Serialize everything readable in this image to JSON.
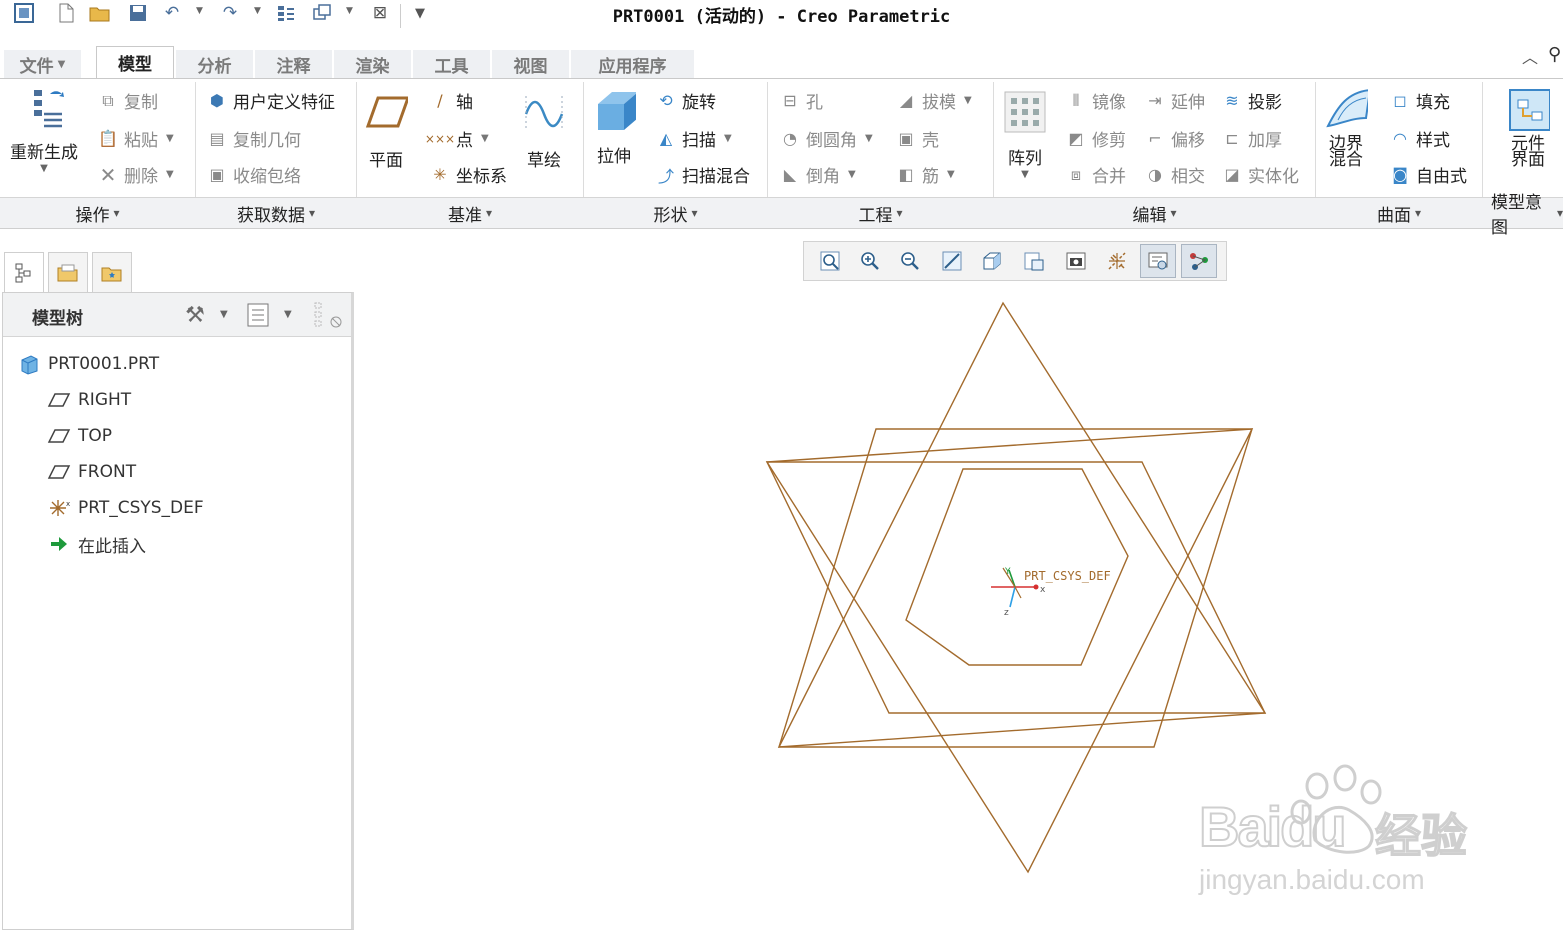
{
  "window": {
    "title": "PRT0001 (活动的) - Creo Parametric"
  },
  "tabs": [
    {
      "label": "文件",
      "dropdown": true
    },
    {
      "label": "模型",
      "active": true
    },
    {
      "label": "分析"
    },
    {
      "label": "注释"
    },
    {
      "label": "渲染"
    },
    {
      "label": "工具"
    },
    {
      "label": "视图"
    },
    {
      "label": "应用程序"
    }
  ],
  "ribbon": {
    "operations": {
      "regen": "重新生成",
      "copy": "复制",
      "paste": "粘贴",
      "delete": "删除",
      "group": "操作"
    },
    "getdata": {
      "udf": "用户定义特征",
      "copy_geom": "复制几何",
      "shrinkwrap": "收缩包络",
      "group": "获取数据"
    },
    "datum": {
      "plane": "平面",
      "axis": "轴",
      "point": "点",
      "csys": "坐标系",
      "sketch": "草绘",
      "group": "基准"
    },
    "shapes": {
      "extrude": "拉伸",
      "revolve": "旋转",
      "sweep": "扫描",
      "swept_blend": "扫描混合",
      "group": "形状"
    },
    "engineering": {
      "hole": "孔",
      "round": "倒圆角",
      "chamfer": "倒角",
      "draft": "拔模",
      "shell": "壳",
      "rib": "筋",
      "group": "工程"
    },
    "pattern": {
      "label": "阵列"
    },
    "editing": {
      "mirror": "镜像",
      "extend": "延伸",
      "project": "投影",
      "trim": "修剪",
      "offset": "偏移",
      "thicken": "加厚",
      "merge": "合并",
      "intersect": "相交",
      "solidify": "实体化",
      "group": "编辑"
    },
    "surfaces": {
      "boundary_blend_1": "边界",
      "boundary_blend_2": "混合",
      "fill": "填充",
      "style": "样式",
      "freestyle": "自由式",
      "group": "曲面"
    },
    "model_intent": {
      "component_interface_1": "元件",
      "component_interface_2": "界面",
      "group": "模型意图"
    }
  },
  "model_tree": {
    "title": "模型树",
    "items": [
      {
        "label": "PRT0001.PRT",
        "icon": "part-icon"
      },
      {
        "label": "RIGHT",
        "icon": "datum-plane-icon"
      },
      {
        "label": "TOP",
        "icon": "datum-plane-icon"
      },
      {
        "label": "FRONT",
        "icon": "datum-plane-icon"
      },
      {
        "label": "PRT_CSYS_DEF",
        "icon": "csys-icon"
      },
      {
        "label": "在此插入",
        "icon": "insert-here-arrow-icon"
      }
    ]
  },
  "viewport": {
    "csys_label": "PRT_CSYS_DEF",
    "sketch_color": "#a36b2d"
  },
  "watermark": {
    "brand": "Bai",
    "brand2": "du",
    "cn": "经验",
    "url": "jingyan.baidu.com"
  }
}
